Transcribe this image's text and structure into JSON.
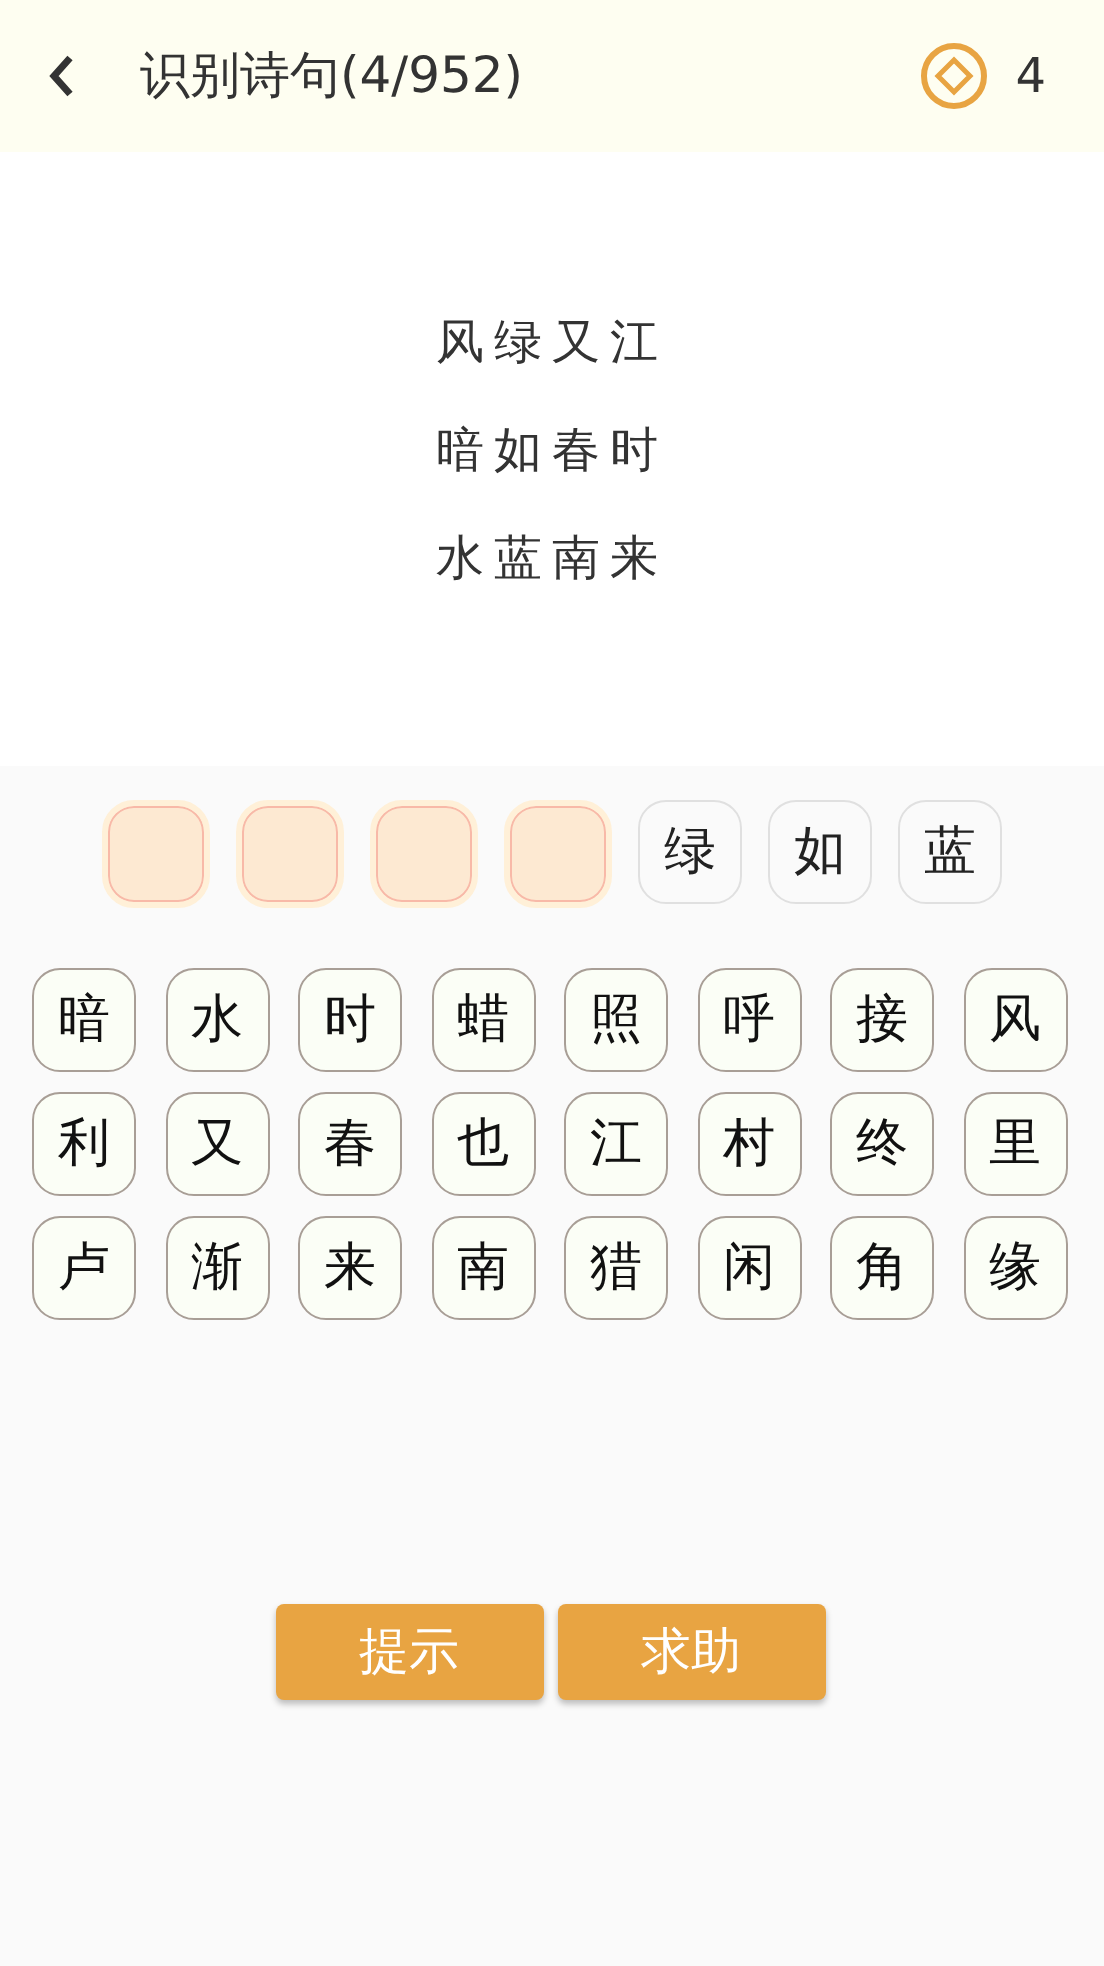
{
  "header": {
    "title": "识别诗句(4/952)",
    "coins": "4"
  },
  "poem_lines": [
    "风绿又江",
    "暗如春时",
    "水蓝南来"
  ],
  "answer_slots": [
    {
      "kind": "blank"
    },
    {
      "kind": "blank"
    },
    {
      "kind": "blank"
    },
    {
      "kind": "blank"
    },
    {
      "kind": "char",
      "text": "绿"
    },
    {
      "kind": "char",
      "text": "如"
    },
    {
      "kind": "char",
      "text": "蓝"
    }
  ],
  "char_tiles": [
    "暗",
    "水",
    "时",
    "蜡",
    "照",
    "呼",
    "接",
    "风",
    "利",
    "又",
    "春",
    "也",
    "江",
    "村",
    "终",
    "里",
    "卢",
    "渐",
    "来",
    "南",
    "猎",
    "闲",
    "角",
    "缘"
  ],
  "buttons": [
    "提示",
    "求助"
  ]
}
